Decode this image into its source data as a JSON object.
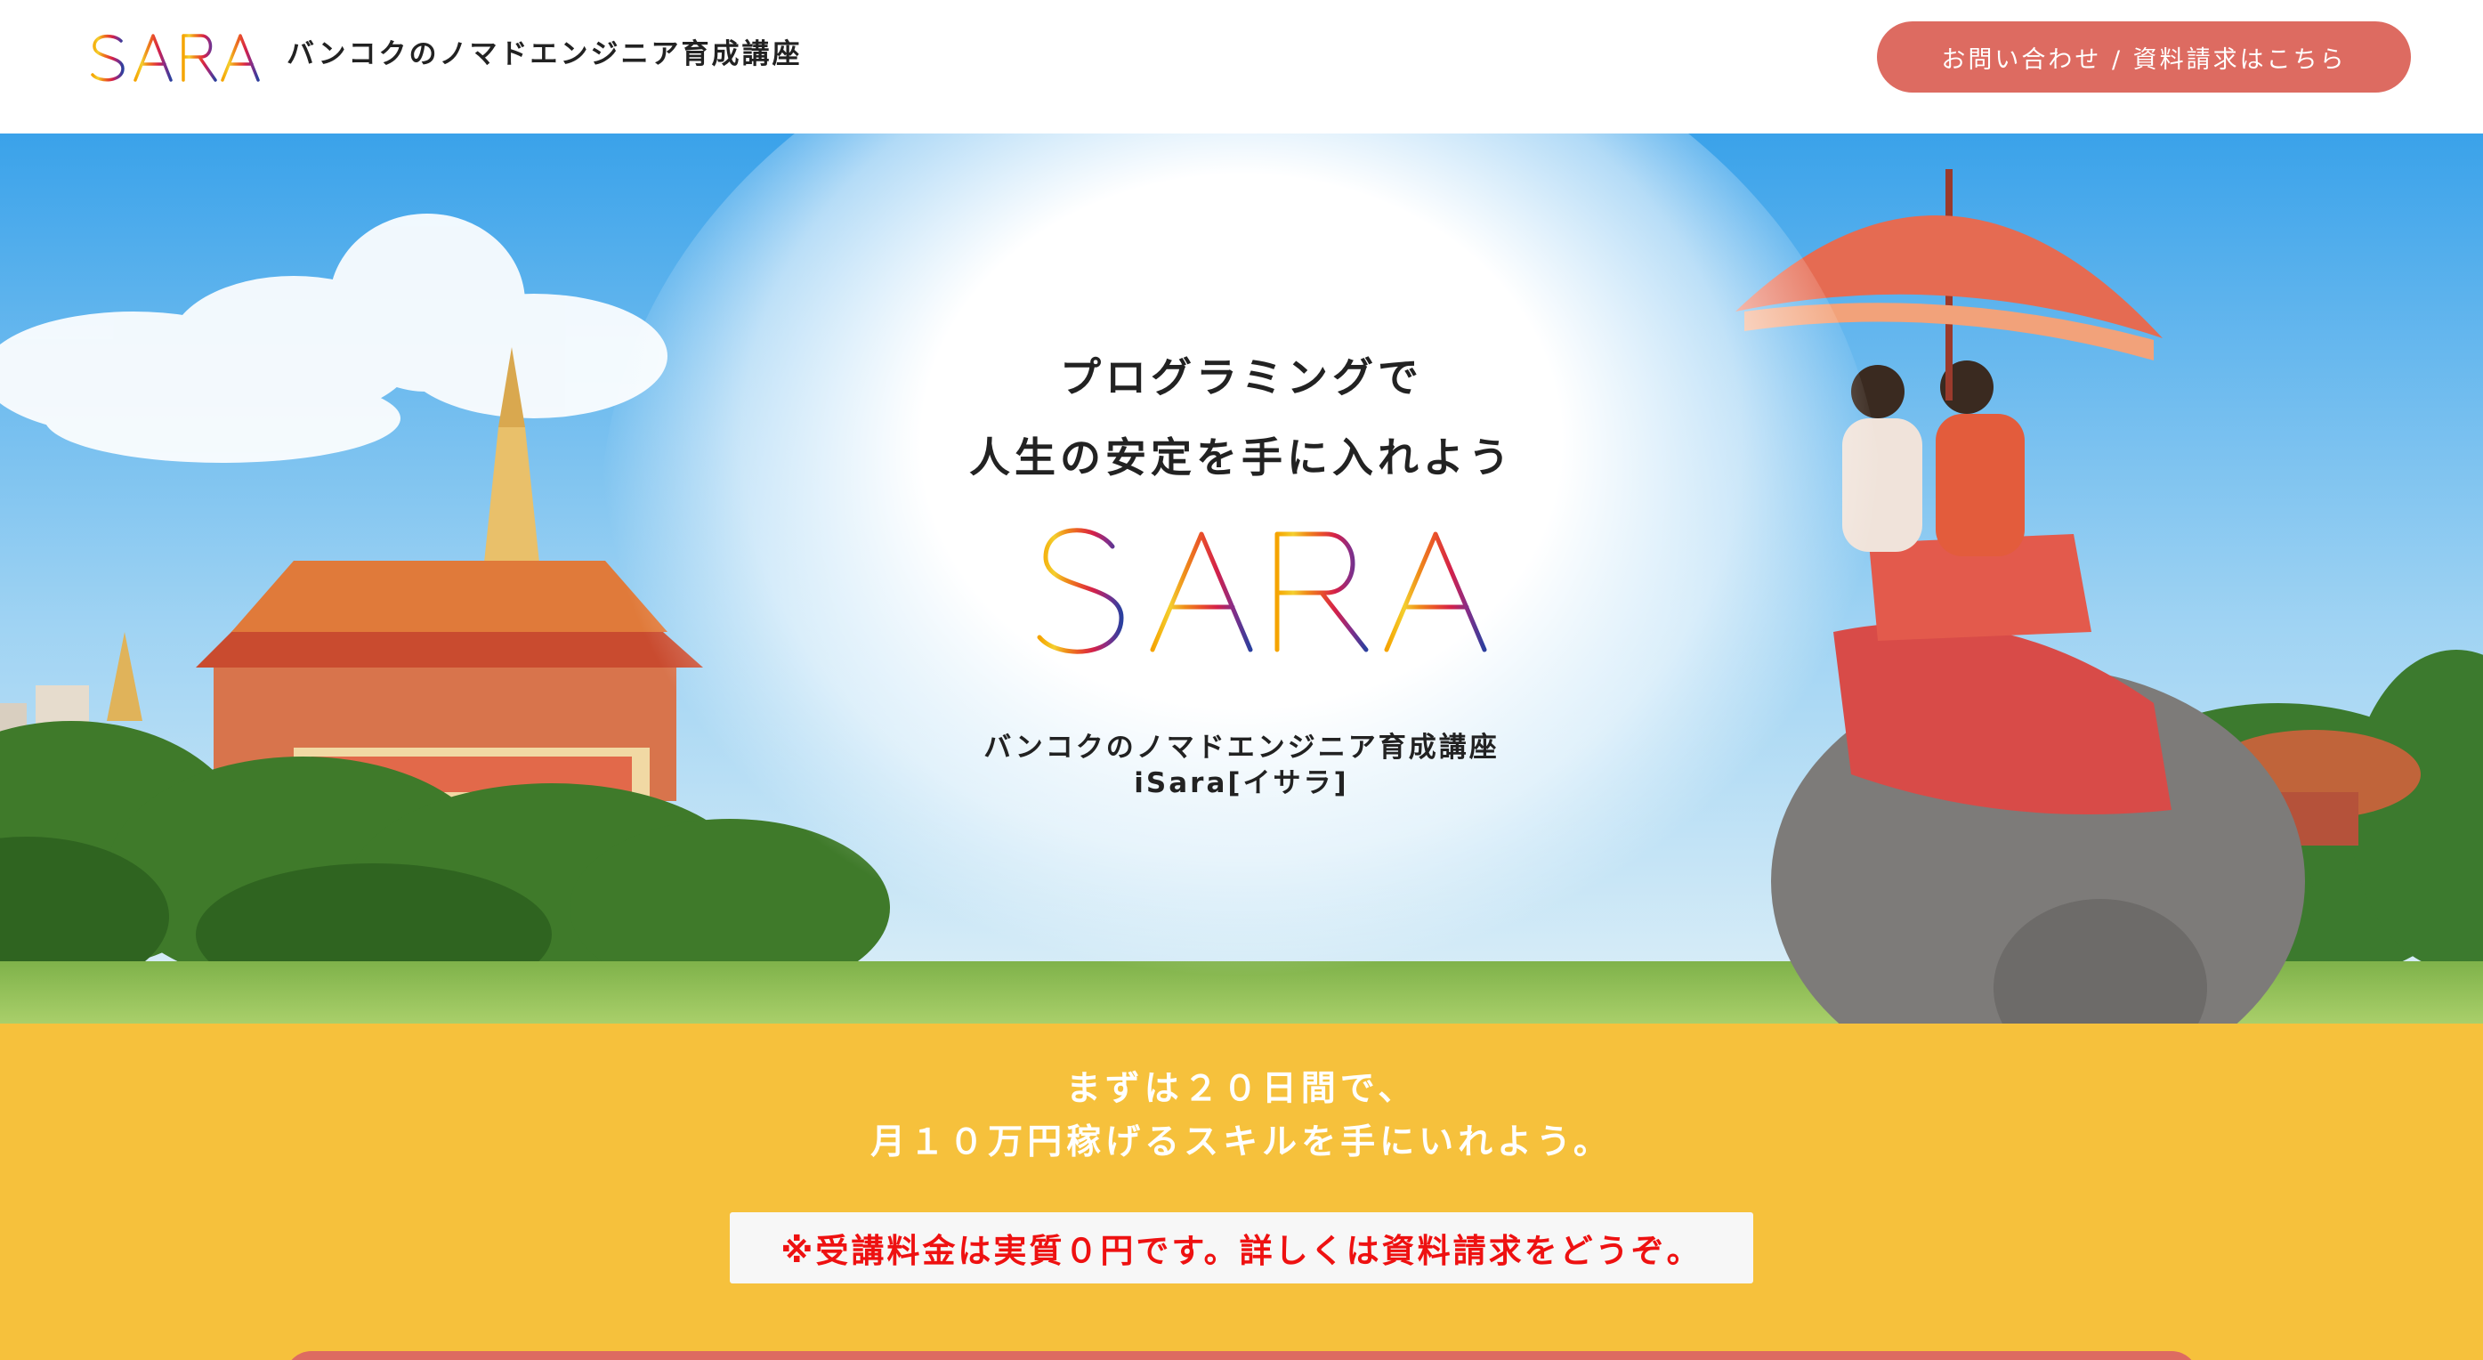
{
  "header": {
    "logo_text": "iSARA",
    "tagline": "バンコクのノマドエンジニア育成講座",
    "cta_label": "お問い合わせ / 資料請求はこちら"
  },
  "hero": {
    "headline_line1": "プログラミングで",
    "headline_line2": "人生の安定を手に入れよう",
    "logo_text": "iSARA",
    "sub_line1": "バンコクのノマドエンジニア育成講座",
    "sub_line2": "iSara[イサラ]"
  },
  "promo": {
    "line1": "まずは２０日間で、",
    "line2": "月１０万円稼げるスキルを手にいれよう。",
    "note": "※受講料金は実質０円です。詳しくは資料請求をどうぞ。"
  },
  "colors": {
    "cta": "#dd6b61",
    "promo_background": "#f6c13c",
    "note_text": "#ee1111"
  }
}
